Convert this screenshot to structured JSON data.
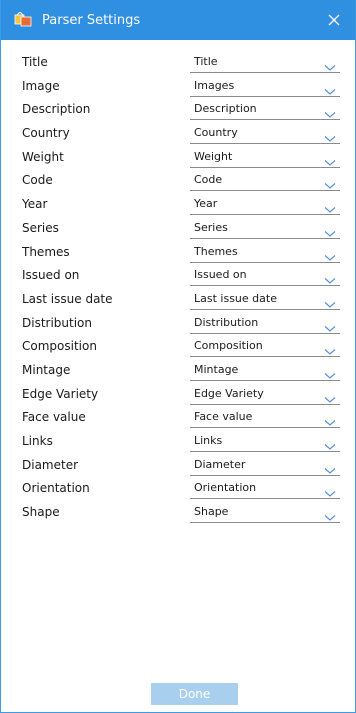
{
  "window": {
    "title": "Parser Settings",
    "accent_color": "#2f8fe0",
    "app_icon": "parser-app-icon",
    "close_icon": "close-icon"
  },
  "fields": [
    {
      "label": "Title",
      "value": "Title"
    },
    {
      "label": "Image",
      "value": "Images"
    },
    {
      "label": "Description",
      "value": "Description"
    },
    {
      "label": "Country",
      "value": "Country"
    },
    {
      "label": "Weight",
      "value": "Weight"
    },
    {
      "label": "Code",
      "value": "Code"
    },
    {
      "label": "Year",
      "value": "Year"
    },
    {
      "label": "Series",
      "value": "Series"
    },
    {
      "label": "Themes",
      "value": "Themes"
    },
    {
      "label": "Issued on",
      "value": "Issued on"
    },
    {
      "label": "Last issue date",
      "value": "Last issue date"
    },
    {
      "label": "Distribution",
      "value": "Distribution"
    },
    {
      "label": "Composition",
      "value": "Composition"
    },
    {
      "label": "Mintage",
      "value": "Mintage"
    },
    {
      "label": "Edge Variety",
      "value": "Edge Variety"
    },
    {
      "label": "Face value",
      "value": "Face value"
    },
    {
      "label": "Links",
      "value": "Links"
    },
    {
      "label": "Diameter",
      "value": "Diameter"
    },
    {
      "label": "Orientation",
      "value": "Orientation"
    },
    {
      "label": "Shape",
      "value": "Shape"
    }
  ],
  "footer": {
    "done_label": "Done",
    "done_enabled": false
  }
}
